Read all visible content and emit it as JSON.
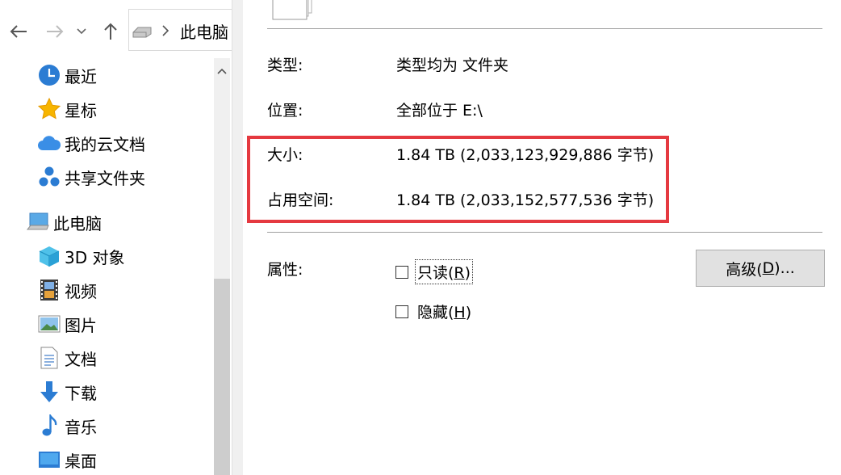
{
  "explorer": {
    "address_path": "此电脑",
    "quick_access": [
      {
        "label": "最近",
        "icon": "clock-icon"
      },
      {
        "label": "星标",
        "icon": "star-icon"
      },
      {
        "label": "我的云文档",
        "icon": "cloud-icon"
      },
      {
        "label": "共享文件夹",
        "icon": "share-icon"
      }
    ],
    "this_pc": {
      "label": "此电脑",
      "icon": "computer-icon"
    },
    "pc_items": [
      {
        "label": "3D 对象",
        "icon": "cube-icon"
      },
      {
        "label": "视频",
        "icon": "film-icon"
      },
      {
        "label": "图片",
        "icon": "picture-icon"
      },
      {
        "label": "文档",
        "icon": "document-icon"
      },
      {
        "label": "下载",
        "icon": "download-icon"
      },
      {
        "label": "音乐",
        "icon": "music-icon"
      },
      {
        "label": "桌面",
        "icon": "desktop-icon"
      }
    ]
  },
  "dialog": {
    "type_label": "类型:",
    "type_value": "类型均为 文件夹",
    "location_label": "位置:",
    "location_value": "全部位于 E:\\",
    "size_label": "大小:",
    "size_value": "1.84 TB (2,033,123,929,886 字节)",
    "disk_size_label": "占用空间:",
    "disk_size_value": "1.84 TB (2,033,152,577,536 字节)",
    "attributes_label": "属性:",
    "readonly_pre": "只读(",
    "readonly_key": "R",
    "readonly_post": ")",
    "hidden_pre": "隐藏(",
    "hidden_key": "H",
    "hidden_post": ")",
    "advanced_pre": "高级(",
    "advanced_key": "D",
    "advanced_post": ")..."
  },
  "colors": {
    "highlight": "#e53940",
    "accent": "#2b7cd3"
  }
}
